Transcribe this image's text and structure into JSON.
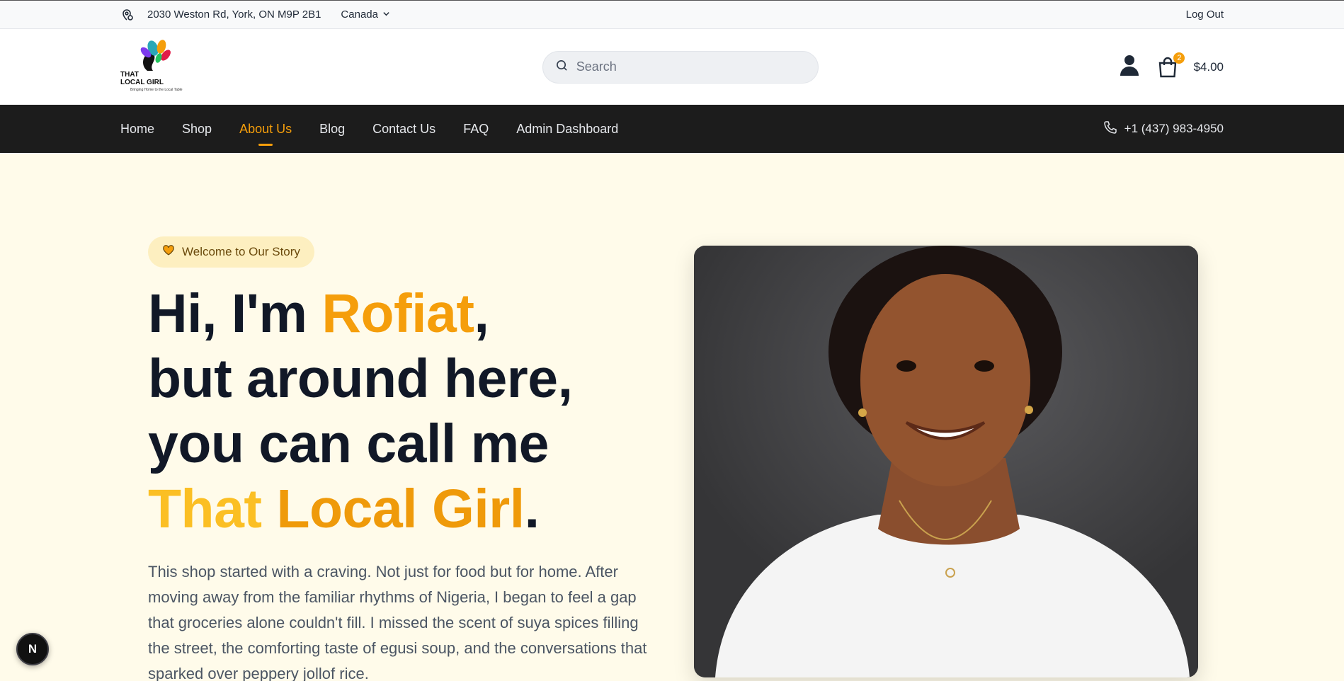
{
  "topbar": {
    "location_icon": "map-pin-icon",
    "address": "2030 Weston Rd, York, ON M9P 2B1",
    "country": "Canada",
    "logout": "Log Out"
  },
  "header": {
    "logo_line1": "THAT",
    "logo_line2": "LOCAL GIRL",
    "logo_tagline": "Bringing Home to the Local Table",
    "search_placeholder": "Search",
    "cart_count": "2",
    "cart_total": "$4.00"
  },
  "nav": {
    "items": [
      {
        "label": "Home"
      },
      {
        "label": "Shop"
      },
      {
        "label": "About Us"
      },
      {
        "label": "Blog"
      },
      {
        "label": "Contact Us"
      },
      {
        "label": "FAQ"
      },
      {
        "label": "Admin Dashboard"
      }
    ],
    "active": "About Us",
    "phone": "+1 (437) 983-4950"
  },
  "hero": {
    "pill": "Welcome to Our Story",
    "headline": {
      "p1": "Hi, I'm ",
      "name": "Rofiat",
      "p2": ", but around here, you can call me ",
      "brand1": "That",
      "brand2": "Local Girl",
      "end": "."
    },
    "story": "This shop started with a craving. Not just for food but for home. After moving away from the familiar rhythms of Nigeria, I began to feel a gap that groceries alone couldn't fill. I missed the scent of suya spices filling the street, the comforting taste of egusi soup, and the conversations that sparked over peppery jollof rice."
  },
  "floating_badge": "N",
  "colors": {
    "accent": "#f59e0b",
    "nav_bg": "#1c1c1c",
    "hero_bg": "#fffbea"
  }
}
